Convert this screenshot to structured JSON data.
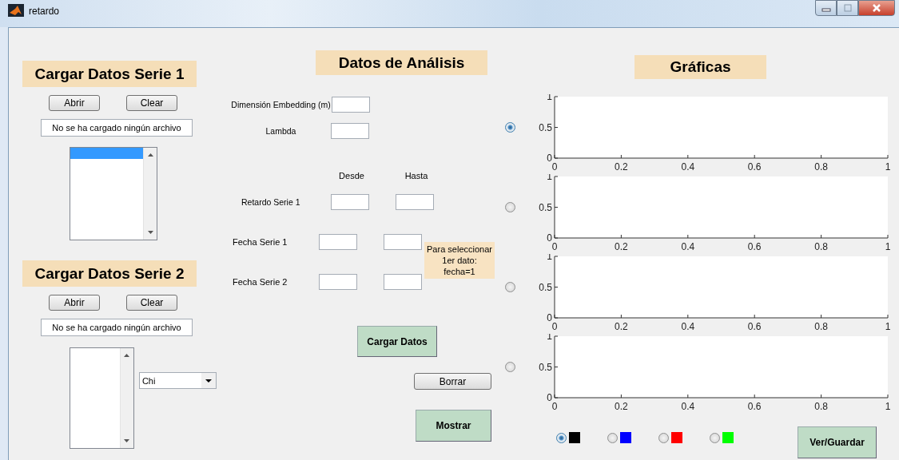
{
  "window": {
    "title": "retardo"
  },
  "series_panels": [
    {
      "title": "Cargar Datos Serie 1",
      "buttons": [
        "Abrir",
        "Clear"
      ],
      "status": "No se ha cargado ningún archivo",
      "listbox": {
        "rows": [
          {
            "selected": true
          }
        ]
      }
    },
    {
      "title": "Cargar Datos Serie 2",
      "buttons": [
        "Abrir",
        "Clear"
      ],
      "status": "No se ha cargado ningún archivo",
      "popup": {
        "value": "Chi"
      }
    }
  ],
  "analysis": {
    "title": "Datos de Análisis",
    "params": [
      {
        "label": "Dimensión Embedding (m)"
      },
      {
        "label": "Lambda"
      }
    ],
    "range_headers": [
      "Desde",
      "Hasta"
    ],
    "ranges": [
      {
        "label": "Retardo Serie 1"
      }
    ],
    "dates": [
      {
        "label": "Fecha Serie 1"
      },
      {
        "label": "Fecha Serie 2"
      }
    ],
    "note": "Para seleccionar\n1er dato:\nfecha=1",
    "buttons": [
      {
        "label": "Cargar Datos",
        "kind": "action"
      },
      {
        "label": "Borrar",
        "kind": "plain"
      },
      {
        "label": "Mostrar",
        "kind": "action"
      }
    ]
  },
  "graphs": {
    "title": "Gráficas",
    "axes": [
      {
        "selected": true,
        "chart_data": {
          "type": "line",
          "xlim": [
            0,
            1
          ],
          "ylim": [
            0,
            1
          ],
          "xticks": [
            0,
            0.2,
            0.4,
            0.6,
            0.8,
            1
          ],
          "yticks": [
            0,
            0.5,
            1
          ]
        }
      },
      {
        "selected": false,
        "chart_data": {
          "type": "line",
          "xlim": [
            0,
            1
          ],
          "ylim": [
            0,
            1
          ],
          "xticks": [
            0,
            0.2,
            0.4,
            0.6,
            0.8,
            1
          ],
          "yticks": [
            0,
            0.5,
            1
          ]
        }
      },
      {
        "selected": false,
        "chart_data": {
          "type": "line",
          "xlim": [
            0,
            1
          ],
          "ylim": [
            0,
            1
          ],
          "xticks": [
            0,
            0.2,
            0.4,
            0.6,
            0.8,
            1
          ],
          "yticks": [
            0,
            0.5,
            1
          ]
        }
      },
      {
        "selected": false,
        "chart_data": {
          "type": "line",
          "xlim": [
            0,
            1
          ],
          "ylim": [
            0,
            1
          ],
          "xticks": [
            0,
            0.2,
            0.4,
            0.6,
            0.8,
            1
          ],
          "yticks": [
            0,
            0.5,
            1
          ]
        }
      }
    ],
    "color_options": [
      {
        "color": "#000000",
        "selected": true
      },
      {
        "color": "#0000ff",
        "selected": false
      },
      {
        "color": "#ff0000",
        "selected": false
      },
      {
        "color": "#00ff00",
        "selected": false
      }
    ],
    "button": "Ver/Guardar"
  }
}
